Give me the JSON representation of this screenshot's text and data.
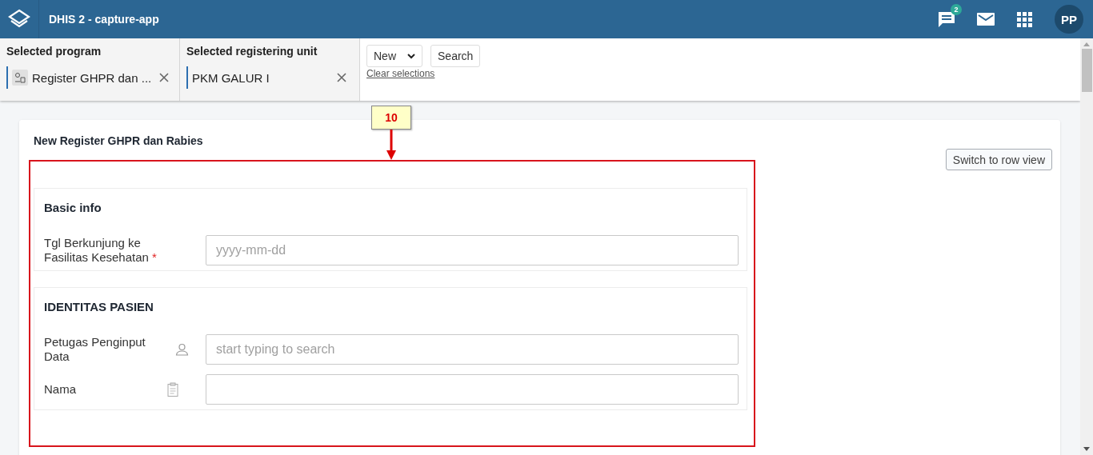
{
  "header": {
    "title": "DHIS 2 - capture-app",
    "messages_badge": "2",
    "avatar": "PP"
  },
  "selectors": [
    {
      "label": "Selected program",
      "value": "Register GHPR dan ...",
      "kind": "program"
    },
    {
      "label": "Selected registering unit",
      "value": "PKM GALUR I",
      "kind": "org_unit"
    }
  ],
  "actions": {
    "new_button": "New",
    "search_button": "Search",
    "clear_link": "Clear selections"
  },
  "form": {
    "title": "New Register GHPR dan Rabies",
    "switch_button": "Switch to row view",
    "sections": [
      {
        "title": "Basic info",
        "fields": [
          {
            "label": "Tgl Berkunjung ke Fasilitas Kesehatan",
            "required_mark": "*",
            "kind": "date",
            "placeholder": "yyyy-mm-dd"
          }
        ]
      },
      {
        "title": "IDENTITAS PASIEN",
        "fields": [
          {
            "label": "Petugas Penginput Data",
            "kind": "lookup",
            "placeholder": "start typing to search"
          },
          {
            "label": "Nama",
            "kind": "text"
          }
        ]
      }
    ]
  },
  "annotation": {
    "label": "10"
  }
}
